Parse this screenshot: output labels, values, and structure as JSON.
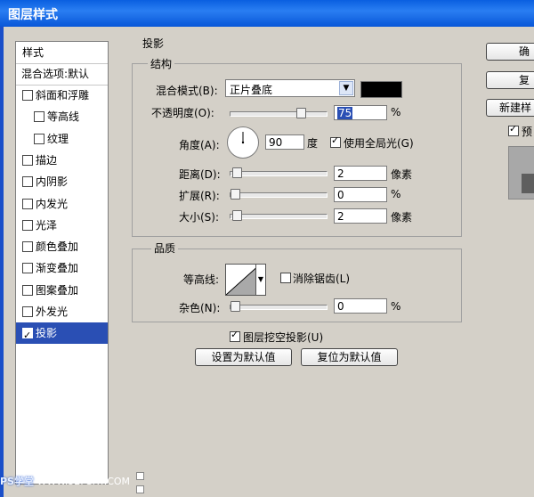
{
  "window": {
    "title": "图层样式"
  },
  "styles_panel": {
    "header": "样式",
    "blend_default": "混合选项:默认",
    "items": [
      {
        "label": "斜面和浮雕",
        "checked": false
      },
      {
        "label": "等高线",
        "checked": false
      },
      {
        "label": "纹理",
        "checked": false
      },
      {
        "label": "描边",
        "checked": false
      },
      {
        "label": "内阴影",
        "checked": false
      },
      {
        "label": "内发光",
        "checked": false
      },
      {
        "label": "光泽",
        "checked": false
      },
      {
        "label": "颜色叠加",
        "checked": false
      },
      {
        "label": "渐变叠加",
        "checked": false
      },
      {
        "label": "图案叠加",
        "checked": false
      },
      {
        "label": "外发光",
        "checked": false
      },
      {
        "label": "投影",
        "checked": true
      }
    ]
  },
  "drop_shadow": {
    "title": "投影",
    "structure": {
      "title": "结构",
      "blend_mode_label": "混合模式(B):",
      "blend_mode_value": "正片叠底",
      "shadow_color": "#000000",
      "opacity_label": "不透明度(O):",
      "opacity_value": "75",
      "opacity_unit": "%",
      "opacity_fraction": 0.75,
      "angle_label": "角度(A):",
      "angle_value": "90",
      "angle_unit": "度",
      "global_light_label": "使用全局光(G)",
      "global_light_checked": true,
      "distance_label": "距离(D):",
      "distance_value": "2",
      "distance_unit": "像素",
      "distance_fraction": 0.02,
      "spread_label": "扩展(R):",
      "spread_value": "0",
      "spread_unit": "%",
      "spread_fraction": 0,
      "size_label": "大小(S):",
      "size_value": "2",
      "size_unit": "像素",
      "size_fraction": 0.02
    },
    "quality": {
      "title": "品质",
      "contour_label": "等高线:",
      "anti_alias_label": "消除锯齿(L)",
      "anti_alias_checked": false,
      "noise_label": "杂色(N):",
      "noise_value": "0",
      "noise_unit": "%",
      "noise_fraction": 0
    },
    "knockout_label": "图层挖空投影(U)",
    "knockout_checked": true,
    "make_default_label": "设置为默认值",
    "reset_default_label": "复位为默认值"
  },
  "right_buttons": {
    "ok_label": "确",
    "cancel_label": "复",
    "new_style_label": "新建样",
    "preview_label": "预",
    "preview_checked": true
  },
  "watermark": {
    "brand": "PS学堂",
    "site": "WWW.52PSXT.COM"
  },
  "icons": {
    "dropdown": "chevron-down-icon",
    "contour": "contour-curve-icon",
    "angle": "angle-dial-icon",
    "check": "checkmark-icon"
  }
}
